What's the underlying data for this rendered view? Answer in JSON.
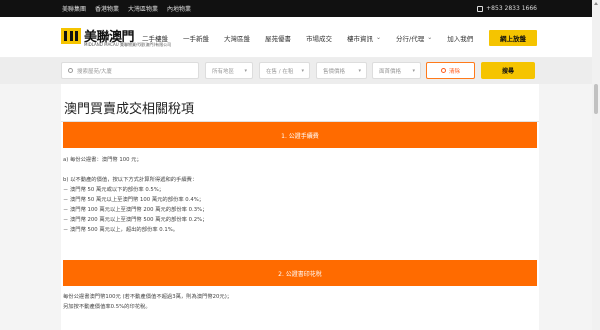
{
  "topbar": {
    "links": [
      "美聯集團",
      "香港物業",
      "大灣區物業",
      "內地物業"
    ],
    "phone": "+853 2833 1666"
  },
  "header": {
    "logo_name": "美聯澳門",
    "logo_sub": "MIDLAND MACAU 美聯物業代理(澳門)有限公司",
    "nav": [
      {
        "label": "二手樓盤",
        "has_menu": false
      },
      {
        "label": "一手新盤",
        "has_menu": false
      },
      {
        "label": "大灣區盤",
        "has_menu": false
      },
      {
        "label": "屋苑優書",
        "has_menu": false
      },
      {
        "label": "市場成交",
        "has_menu": false
      },
      {
        "label": "樓市資訊",
        "has_menu": true
      },
      {
        "label": "分行/代理",
        "has_menu": true
      },
      {
        "label": "加入我們",
        "has_menu": false
      }
    ],
    "cta": "網上放盤"
  },
  "search": {
    "keyword_placeholder": "搜索屋苑/大廈",
    "district": "所有地區",
    "type": "在售 / 在租",
    "sale_price": "售價價格",
    "rent_price": "面首價格",
    "clear_label": "清除",
    "search_label": "搜尋"
  },
  "page": {
    "title": "澳門買賣成交相關稅項",
    "sections": [
      {
        "heading": "1. 公證手續費",
        "lines": [
          "a) 每份公證書：澳門幣 100 元；",
          "",
          "b) 以不動產的價值，按以下方式計算所得遞和的手續費：",
          "－ 澳門幣 50 萬元或以下的部份率 0.5%；",
          "－ 澳門幣 50 萬元以上至澳門幣 100 萬元的部份率 0.4%；",
          "－ 澳門幣 100 萬元以上至澳門幣 200 萬元的部份率 0.3%；",
          "－ 澳門幣 200 萬元以上至澳門幣 500 萬元的部份率 0.2%；",
          "－ 澳門幣 500 萬元以上，超出的部份率 0.1%。"
        ]
      },
      {
        "heading": "2. 公證書印花稅",
        "lines": [
          "每份公證書澳門幣100元 (若不動產價值不超過3萬，則為澳門幣20元)；",
          "另加按不動產價值率0.5%的印花稅。"
        ]
      }
    ]
  },
  "colors": {
    "accent_orange": "#ff6b00",
    "brand_yellow": "#f5c400"
  }
}
